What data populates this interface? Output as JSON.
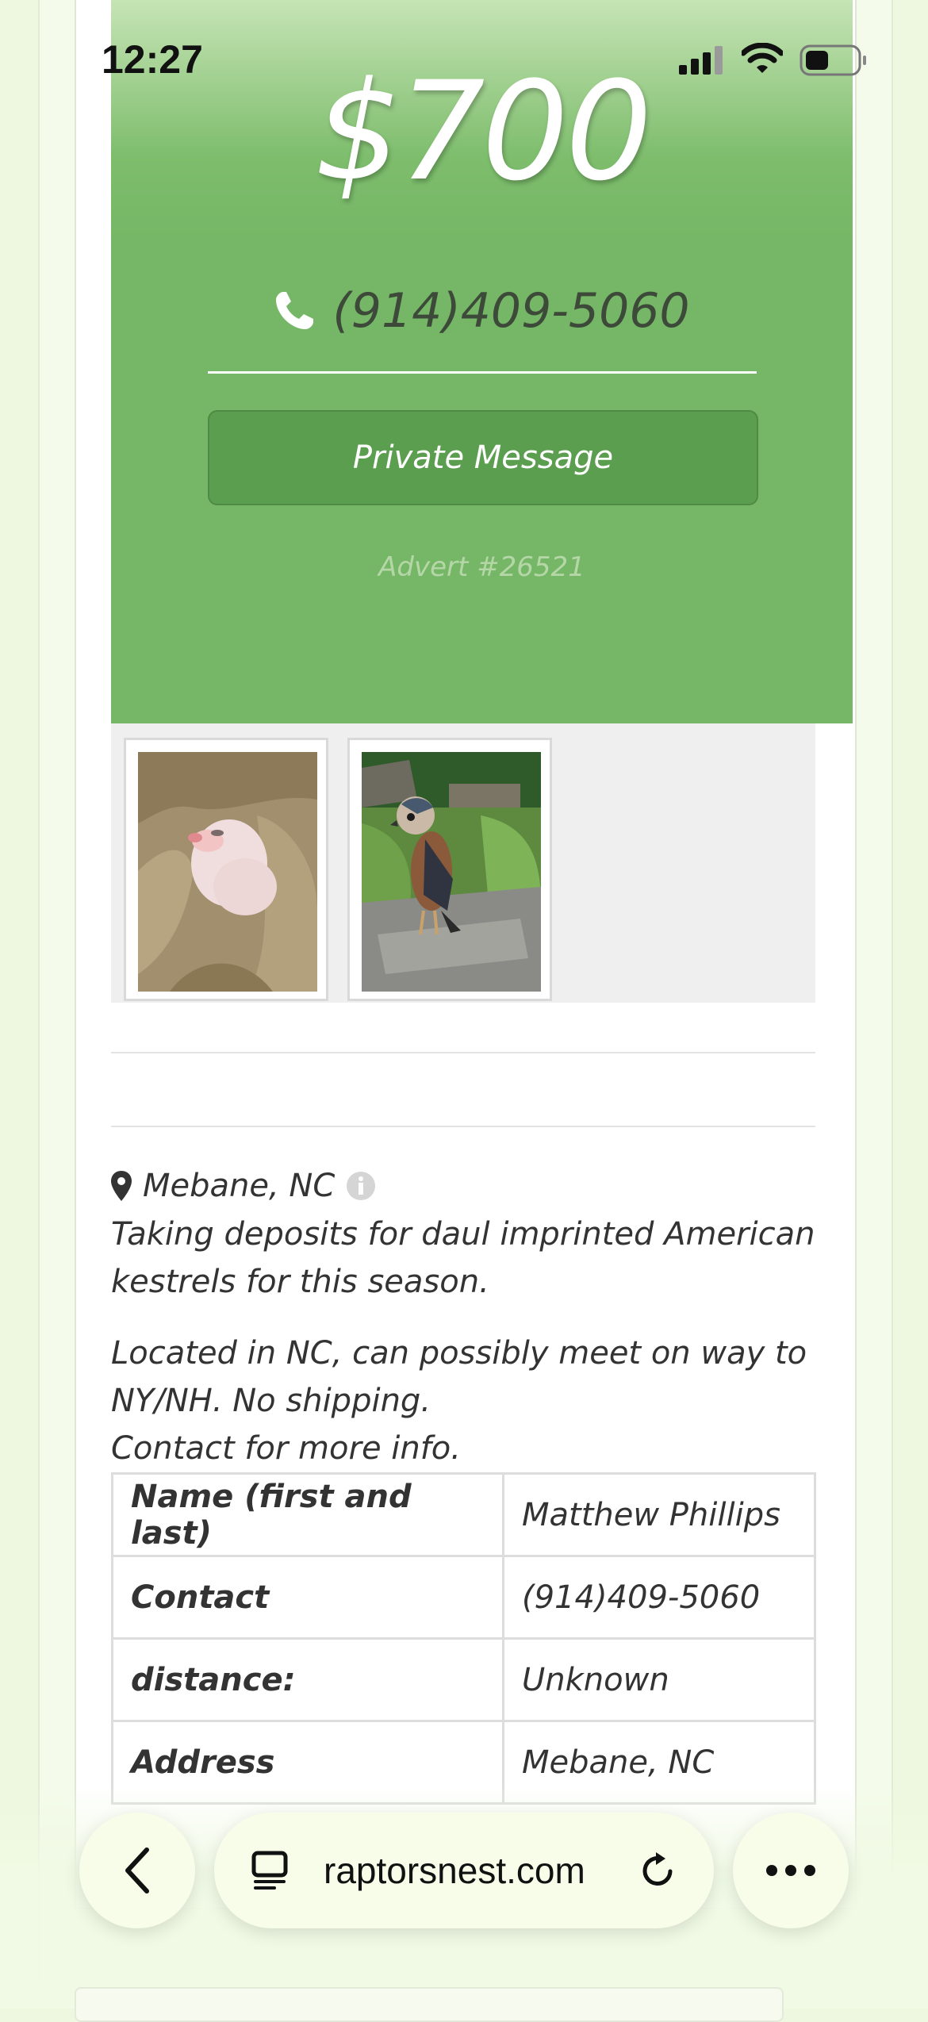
{
  "status_bar": {
    "time": "12:27",
    "battery_level": 0.45
  },
  "listing": {
    "price": "$700",
    "phone": "(914)409-5060",
    "private_message_label": "Private Message",
    "advert_id": "Advert #26521",
    "location": "Mebane, NC",
    "description_1": "Taking deposits for daul imprinted American kestrels for this season.",
    "description_2_line1": "Located in NC, can possibly meet on way to NY/NH. No shipping.",
    "description_2_line2": "Contact for more info."
  },
  "details_table": [
    {
      "label": "Name (first and last)",
      "value": "Matthew Phillips"
    },
    {
      "label": "Contact",
      "value": "(914)409-5060"
    },
    {
      "label": "distance:",
      "value": "Unknown"
    },
    {
      "label": "Address",
      "value": "Mebane, NC"
    }
  ],
  "browser": {
    "url": "raptorsnest.com"
  },
  "colors": {
    "panel_green": "#75b766",
    "button_green": "#5c9e4f",
    "browser_bg": "#f7fde9"
  }
}
